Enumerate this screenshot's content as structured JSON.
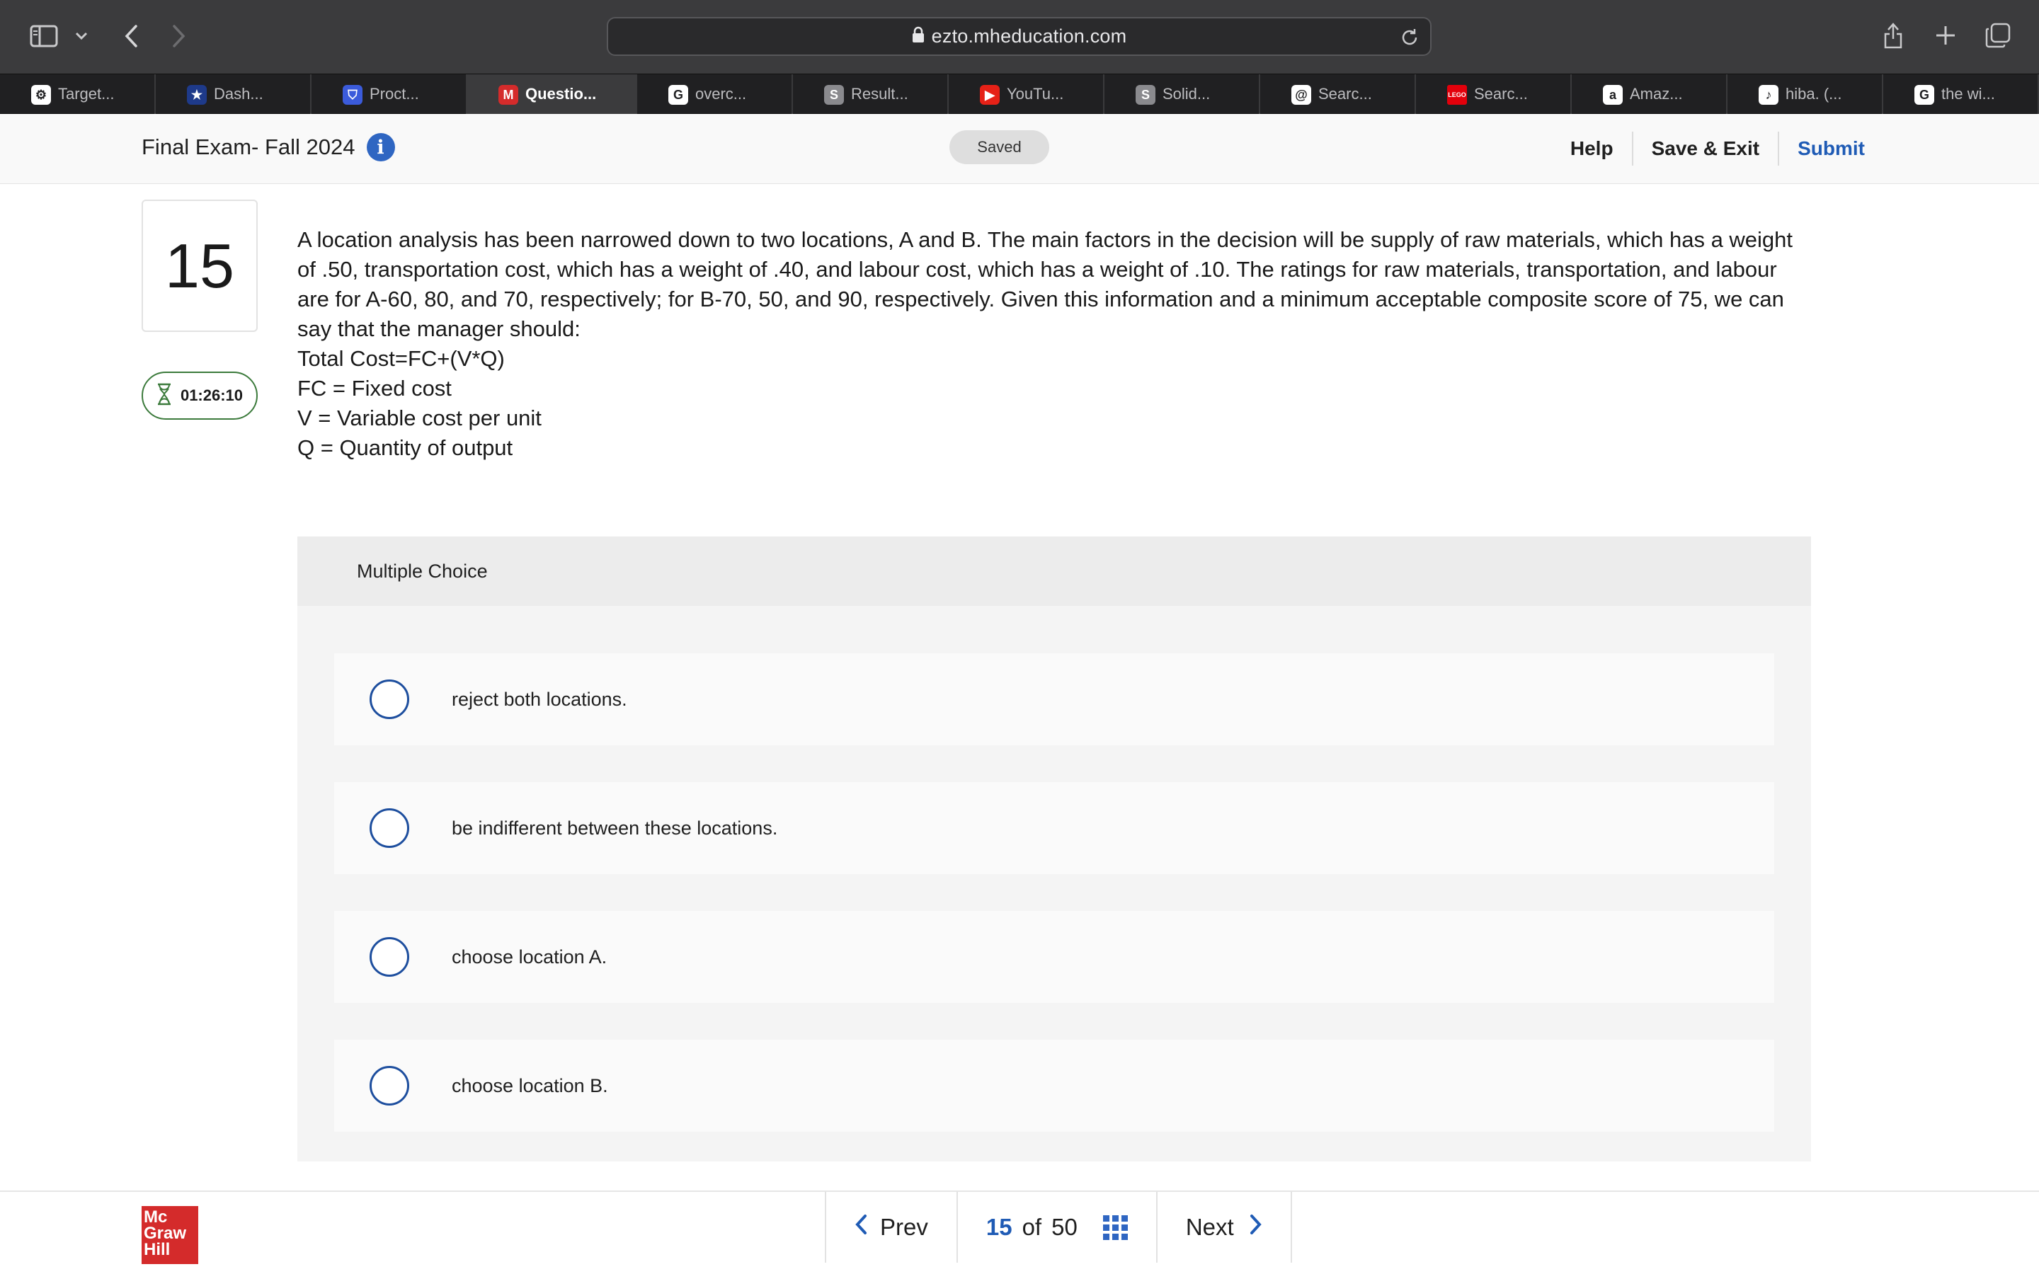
{
  "browser": {
    "url": "ezto.mheducation.com",
    "tabs": [
      {
        "label": "Target...",
        "icon": "chatgpt-icon",
        "color": "#ffffff",
        "glyph": "⚙"
      },
      {
        "label": "Dash...",
        "icon": "star-badge-icon",
        "color": "#1e3a8a",
        "glyph": "★"
      },
      {
        "label": "Proct...",
        "icon": "shield-icon",
        "color": "#3b5bdb",
        "glyph": "⛉"
      },
      {
        "label": "Questio...",
        "icon": "mcgraw-m-icon",
        "color": "#d42b2b",
        "glyph": "M"
      },
      {
        "label": "overc...",
        "icon": "google-icon",
        "color": "#ffffff",
        "glyph": "G"
      },
      {
        "label": "Result...",
        "icon": "s-icon",
        "color": "#8a8a8e",
        "glyph": "S"
      },
      {
        "label": "YouTu...",
        "icon": "youtube-icon",
        "color": "#e62117",
        "glyph": "▶"
      },
      {
        "label": "Solid...",
        "icon": "s-icon",
        "color": "#8a8a8e",
        "glyph": "S"
      },
      {
        "label": "Searc...",
        "icon": "at-icon",
        "color": "#ffffff",
        "glyph": "@"
      },
      {
        "label": "Searc...",
        "icon": "lego-icon",
        "color": "#e3000b",
        "glyph": "LEGO"
      },
      {
        "label": "Amaz...",
        "icon": "amazon-icon",
        "color": "#ffffff",
        "glyph": "a"
      },
      {
        "label": "hiba. (...",
        "icon": "tiktok-icon",
        "color": "#ffffff",
        "glyph": "♪"
      },
      {
        "label": "the wi...",
        "icon": "google-icon",
        "color": "#ffffff",
        "glyph": "G"
      }
    ]
  },
  "header": {
    "title": "Final Exam- Fall 2024",
    "saved": "Saved",
    "help": "Help",
    "save_exit": "Save & Exit",
    "submit": "Submit"
  },
  "question": {
    "number": "15",
    "timer": "01:26:10",
    "text": "A location analysis has been narrowed down to two locations, A and B. The main factors in the decision will be supply of raw materials, which has a weight of .50, transportation cost, which has a weight of .40, and labour cost, which has a weight of .10. The ratings for raw materials, transportation, and labour are for A-60, 80, and 70, respectively; for B-70, 50, and 90, respectively. Given this information and a minimum acceptable composite score of 75, we can say that the manager should:",
    "lines": [
      "Total Cost=FC+(V*Q)",
      "FC = Fixed cost",
      "V = Variable cost per unit",
      "Q = Quantity of output"
    ]
  },
  "multiple_choice": {
    "header": "Multiple Choice",
    "options": [
      "reject both locations.",
      "be indifferent between these locations.",
      "choose location A.",
      "choose location B."
    ]
  },
  "footer": {
    "logo_lines": [
      "Mc",
      "Graw",
      "Hill"
    ],
    "prev": "Prev",
    "current": "15",
    "of": "of",
    "total": "50",
    "next": "Next"
  },
  "colors": {
    "accent_blue": "#1f5bb5",
    "timer_green": "#3b7a3b",
    "brand_red": "#d42b2b"
  }
}
